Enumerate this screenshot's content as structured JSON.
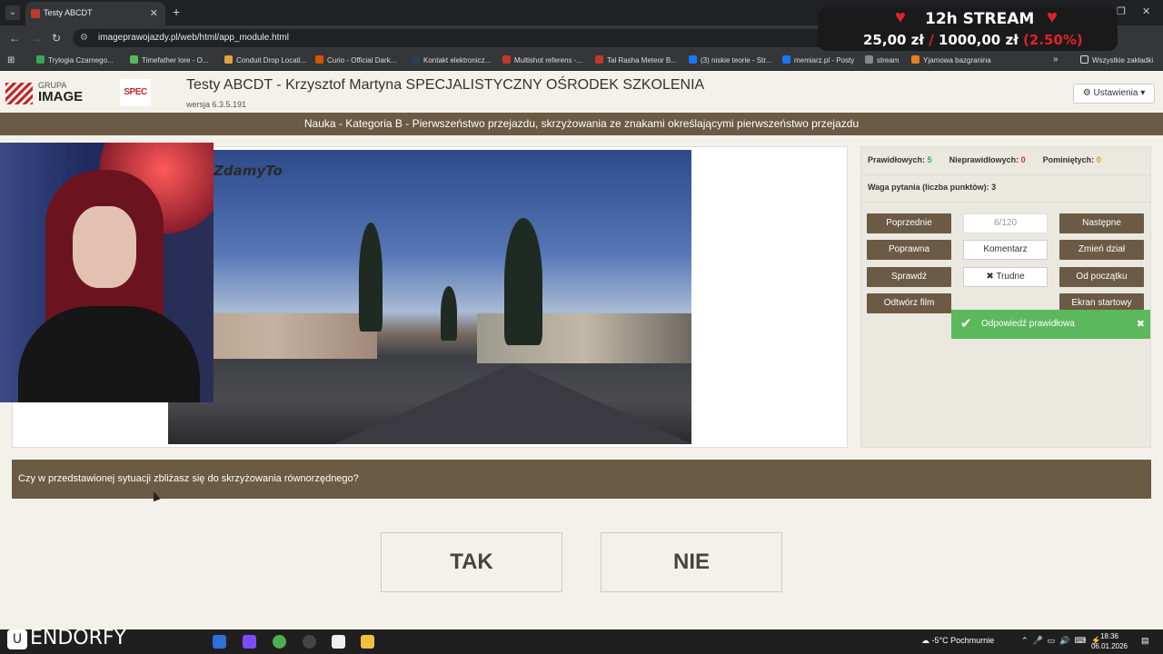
{
  "browser": {
    "tab_title": "Testy ABCDT",
    "url": "imageprawojazdy.pl/web/html/app_module.html",
    "bookmarks": [
      {
        "label": "Trylogia Czarnego...",
        "color": "#3aa655"
      },
      {
        "label": "Timefather lore - O...",
        "color": "#5cb85c"
      },
      {
        "label": "Conduit Drop Locati...",
        "color": "#e6a23c"
      },
      {
        "label": "Curio - Official Dark...",
        "color": "#d35400"
      },
      {
        "label": "Kontakt elektronicz...",
        "color": "#2c3e50"
      },
      {
        "label": "Multishot referens -...",
        "color": "#c0392b"
      },
      {
        "label": "Tal Rasha Meteor B...",
        "color": "#c0392b"
      },
      {
        "label": "(3) niskie teorie - Str...",
        "color": "#1877f2"
      },
      {
        "label": "memiarz.pl - Posty",
        "color": "#1877f2"
      },
      {
        "label": "stream",
        "color": "#888888"
      },
      {
        "label": "Yjamowa bazgranina",
        "color": "#e67e22"
      }
    ],
    "all_bookmarks": "Wszystkie zakładki"
  },
  "stream_overlay": {
    "title": "12h STREAM",
    "amount": "25,00 zł",
    "separator": "/",
    "goal": "1000,00 zł",
    "percent": "(2.50%)"
  },
  "header": {
    "logo_line1": "GRUPA",
    "logo_line2": "IMAGE",
    "spec_logo": "SPEC",
    "title": "Testy ABCDT - Krzysztof Martyna SPECJALISTYCZNY OŚRODEK SZKOLENIA",
    "version": "wersja 6.3.5.191",
    "settings_label": "Ustawienia"
  },
  "category": "Nauka - Kategoria B - Pierwszeństwo przejazdu, skrzyżowania ze znakami określającymi pierwszeństwo przejazdu",
  "video": {
    "watermark": "ZdamyTo"
  },
  "stats": {
    "correct_label": "Prawidłowych:",
    "correct_value": "5",
    "incorrect_label": "Nieprawidłowych:",
    "incorrect_value": "0",
    "skipped_label": "Pominiętych:",
    "skipped_value": "0",
    "weight_label": "Waga pytania (liczba punktów): 3"
  },
  "buttons": {
    "prev": "Poprzednie",
    "counter": "6/120",
    "next": "Następne",
    "correct": "Poprawna",
    "comment": "Komentarz",
    "change_section": "Zmień dział",
    "check": "Sprawdź",
    "hard": "Trudne",
    "from_start": "Od początku",
    "open_film": "Odtwórz film",
    "start_screen": "Ekran startowy"
  },
  "toast": {
    "text": "Odpowiedź prawidłowa"
  },
  "question": "Czy w przedstawionej sytuacji zbliżasz się do skrzyżowania równorzędnego?",
  "answers": {
    "yes": "TAK",
    "no": "NIE"
  },
  "taskbar": {
    "brand": "ENDORFY",
    "weather": "-5°C Pochmurnie",
    "time": "18:36",
    "date": "06.01.2026"
  }
}
